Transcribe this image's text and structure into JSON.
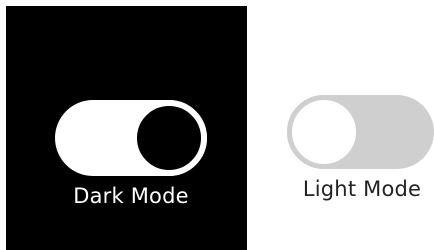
{
  "dark_mode": {
    "label": "Dark Mode",
    "toggle_state": "on",
    "track_color": "#ffffff",
    "knob_color": "#000000",
    "background_color": "#000000"
  },
  "light_mode": {
    "label": "Light Mode",
    "toggle_state": "off",
    "track_color": "#cfcfcf",
    "knob_color": "#ffffff",
    "background_color": "#ffffff"
  }
}
